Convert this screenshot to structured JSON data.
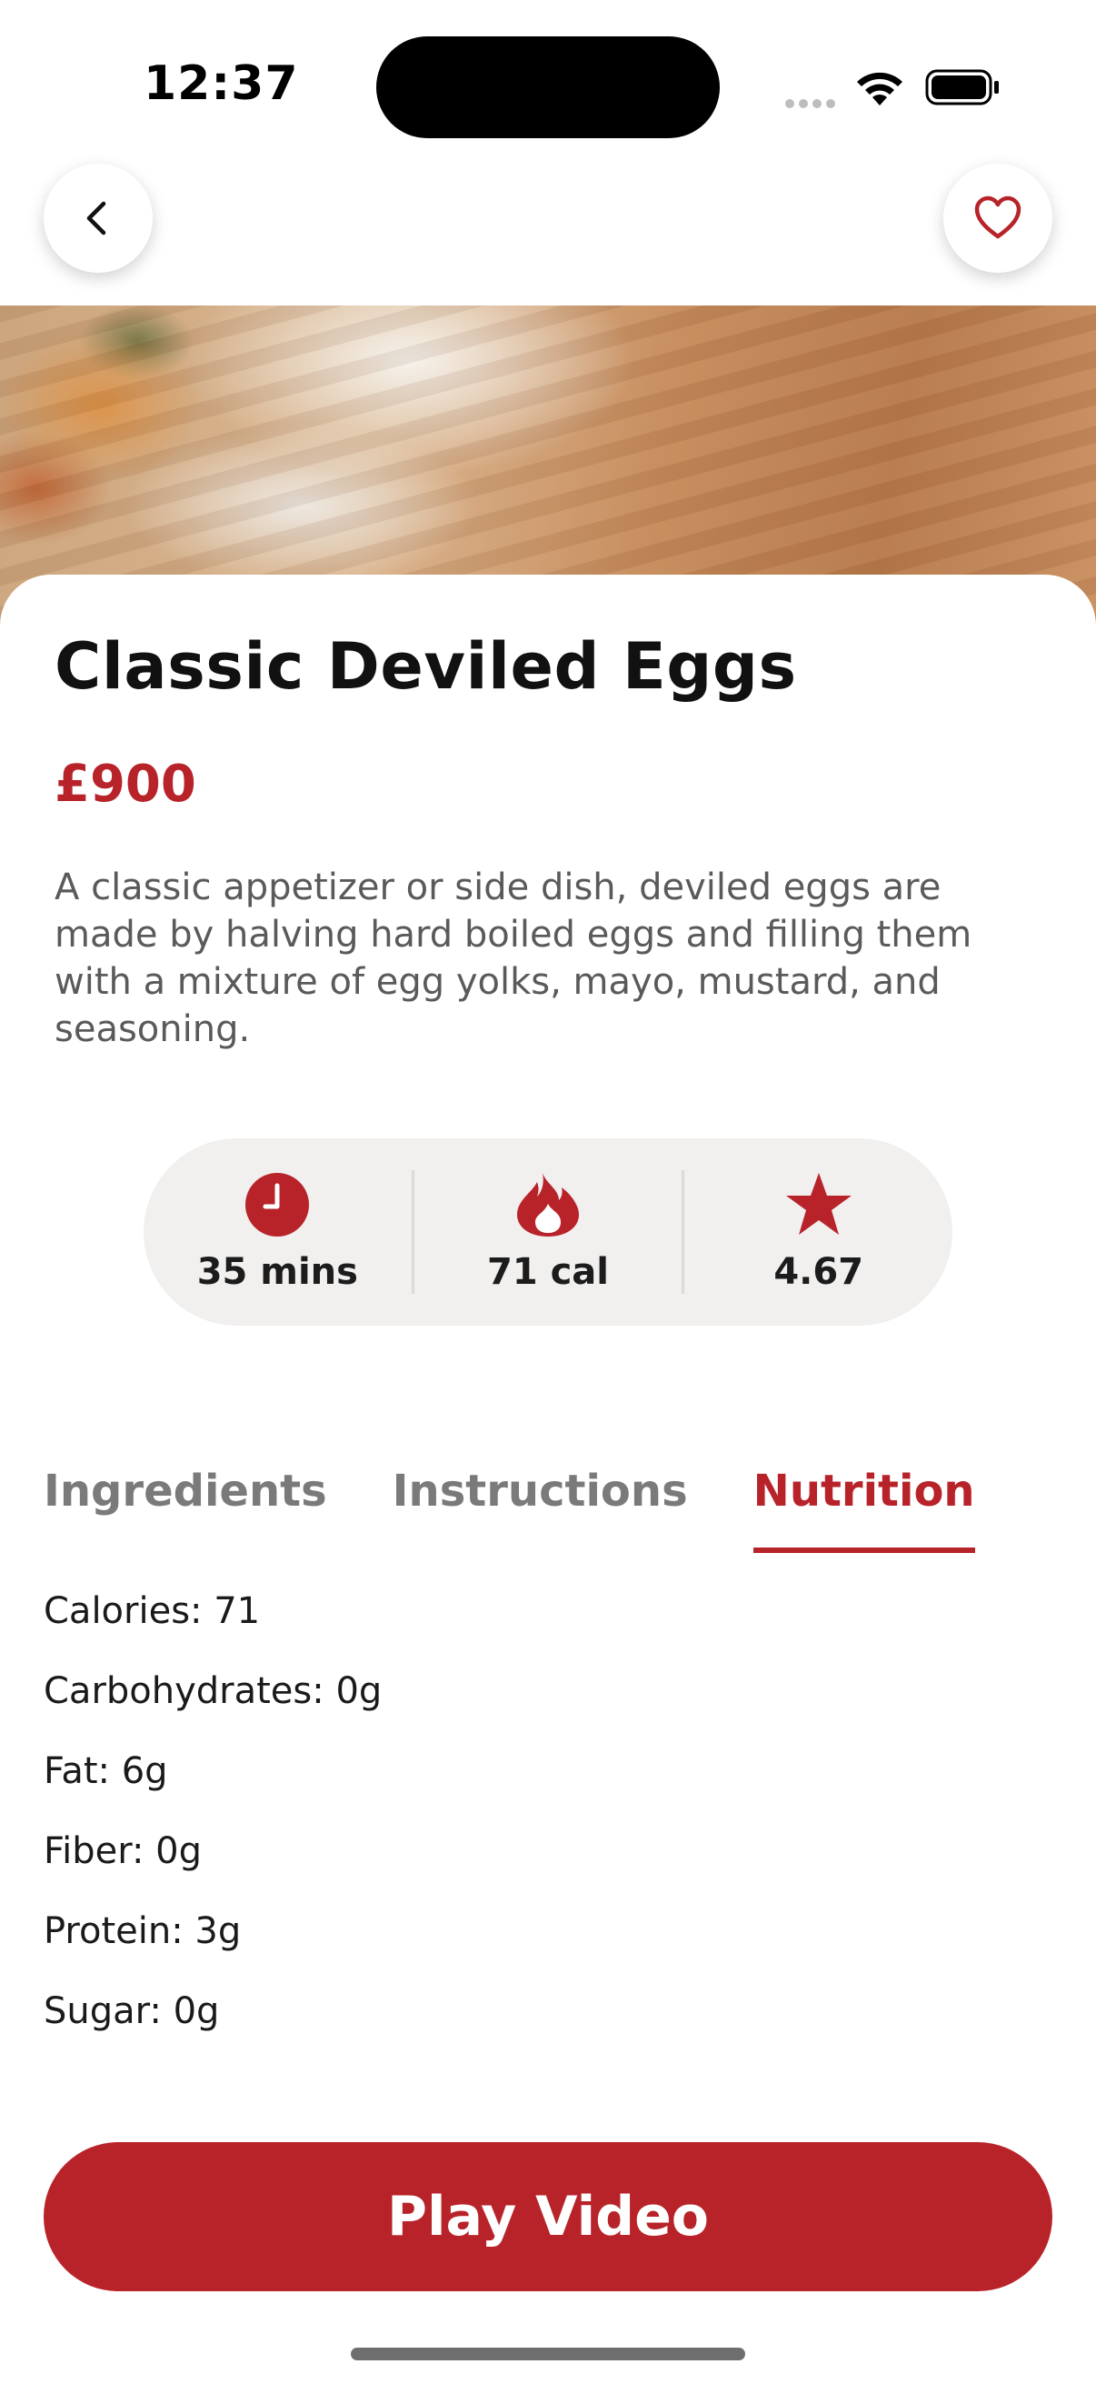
{
  "status_bar": {
    "time": "12:37"
  },
  "header": {
    "back_icon": "chevron-left-icon",
    "favorite_icon": "heart-outline-icon"
  },
  "recipe": {
    "title": "Classic Deviled Eggs",
    "price": "£900",
    "description": "A classic appetizer or side dish, deviled eggs are made by halving hard boiled eggs and filling them with a mixture of egg yolks, mayo, mustard, and seasoning."
  },
  "stats": [
    {
      "icon": "clock-icon",
      "value": "35 mins"
    },
    {
      "icon": "flame-icon",
      "value": "71 cal"
    },
    {
      "icon": "star-icon",
      "value": "4.67"
    }
  ],
  "tabs": {
    "items": [
      "Ingredients",
      "Instructions",
      "Nutrition"
    ],
    "active": "Nutrition"
  },
  "nutrition": [
    "Calories: 71",
    "Carbohydrates: 0g",
    "Fat: 6g",
    "Fiber: 0g",
    "Protein: 3g",
    "Sugar: 0g"
  ],
  "actions": {
    "play_video_label": "Play Video"
  },
  "colors": {
    "accent": "#b8232a",
    "stats_background": "#f1f0ef",
    "text_muted": "#5a5a5a"
  }
}
